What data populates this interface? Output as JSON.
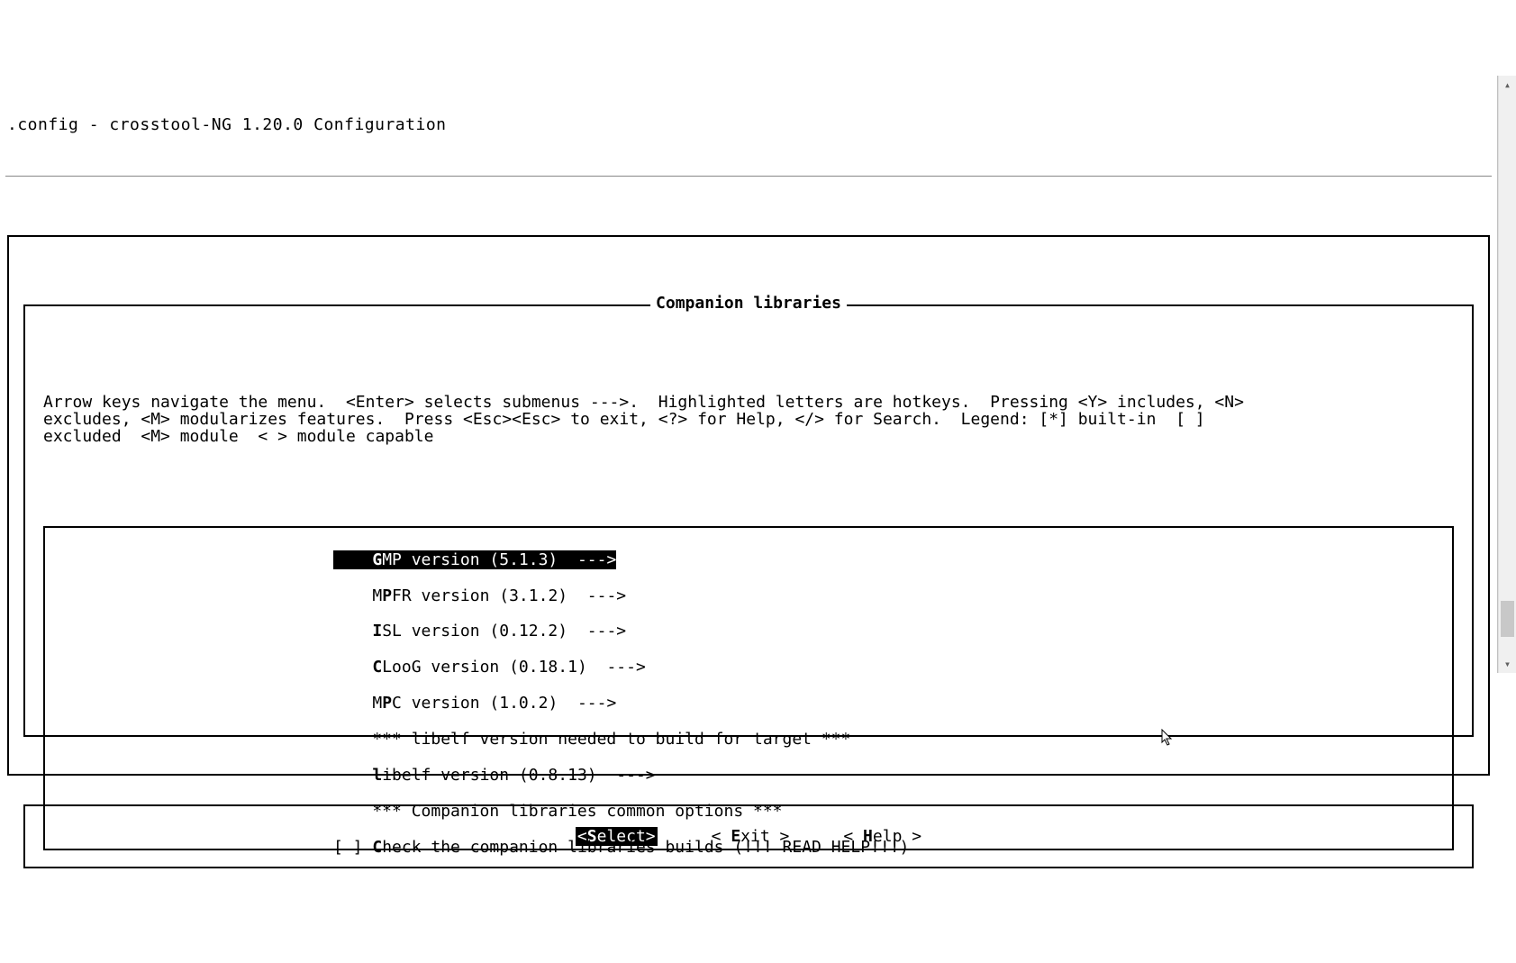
{
  "window_title": ".config - crosstool-NG 1.20.0 Configuration",
  "section_title": "Companion libraries",
  "help": {
    "line1": "Arrow keys navigate the menu.  <Enter> selects submenus --->.  Highlighted letters are hotkeys.  Pressing <Y> includes, <N>",
    "line2": "excludes, <M> modularizes features.  Press <Esc><Esc> to exit, <?> for Help, </> for Search.  Legend: [*] built-in  [ ]",
    "line3": "excluded  <M> module  < > module capable"
  },
  "menu": {
    "gmp": {
      "prefix": "    ",
      "hot": "G",
      "rest": "MP version (5.1.3)  --->",
      "selected": true
    },
    "mpfr": {
      "prefix": "    ",
      "pre": "M",
      "hot": "P",
      "rest": "FR version (3.1.2)  --->"
    },
    "isl": {
      "prefix": "    ",
      "hot": "I",
      "rest": "SL version (0.12.2)  --->"
    },
    "cloog": {
      "prefix": "    ",
      "hot": "C",
      "rest": "LooG version (0.18.1)  --->"
    },
    "mpc": {
      "prefix": "    ",
      "pre": "M",
      "hot": "P",
      "rest": "C version (1.0.2)  --->"
    },
    "note1": {
      "text": "    *** libelf version needed to build for target ***"
    },
    "libelf": {
      "prefix": "    ",
      "hot": "l",
      "rest": "ibelf version (0.8.13)  --->"
    },
    "note2": {
      "text": "    *** Companion libraries common options ***"
    },
    "check": {
      "prefix": "[ ] ",
      "hot": "C",
      "rest": "heck the companion libraries builds (!!! READ HELP!!!)"
    }
  },
  "buttons": {
    "select": {
      "label_open": "<",
      "hot": "S",
      "rest": "elect>",
      "active": true
    },
    "exit": {
      "open": "< ",
      "hot": "E",
      "rest": "xit >"
    },
    "help": {
      "open": "< ",
      "hot": "H",
      "rest": "elp >"
    }
  }
}
